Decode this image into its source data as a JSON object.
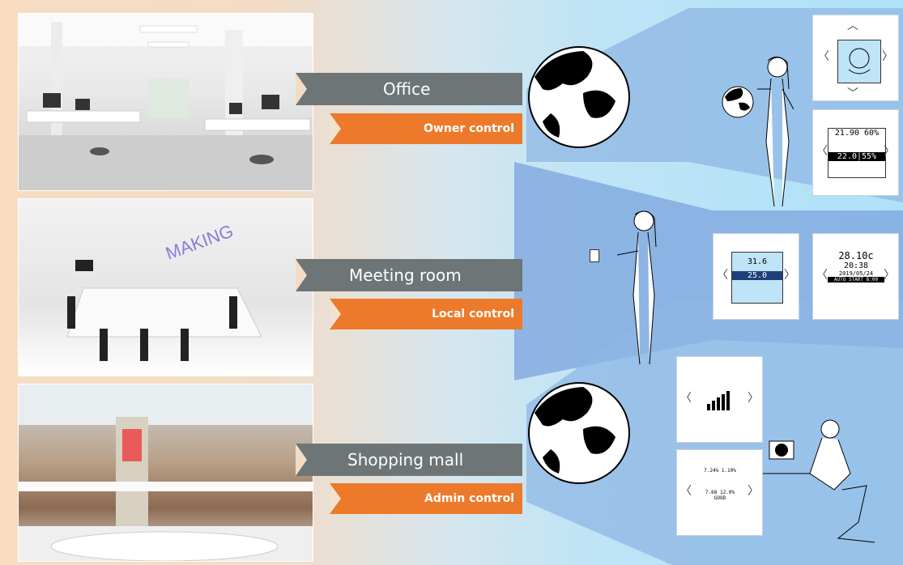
{
  "rows": [
    {
      "scene": "Office",
      "control": "Owner control"
    },
    {
      "scene": "Meeting room",
      "control": "Local control"
    },
    {
      "scene": "Shopping mall",
      "control": "Admin control"
    }
  ],
  "panels": {
    "p2": {
      "temp": "21.90",
      "hum": "60%",
      "set_temp": "22.0",
      "set_hum": "55%"
    },
    "p3": {
      "top": "31.6",
      "value": "25.0"
    },
    "p4": {
      "temp": "28.10c",
      "time": "20:38",
      "date": "2019/05/24",
      "mode": "AUTO START 8:00"
    },
    "p6": {
      "a": "7.24%",
      "b": "1.10%",
      "c": "7.68",
      "d": "12.0%",
      "e": "GOOD"
    }
  },
  "colors": {
    "dark_label": "#6e7576",
    "orange_label": "#ec7a2a",
    "blue_beam": "#8fb7e4"
  },
  "icons": [
    "globe-icon",
    "person-icon",
    "hand-globe-icon",
    "signal-bars-icon",
    "desk-icon"
  ]
}
